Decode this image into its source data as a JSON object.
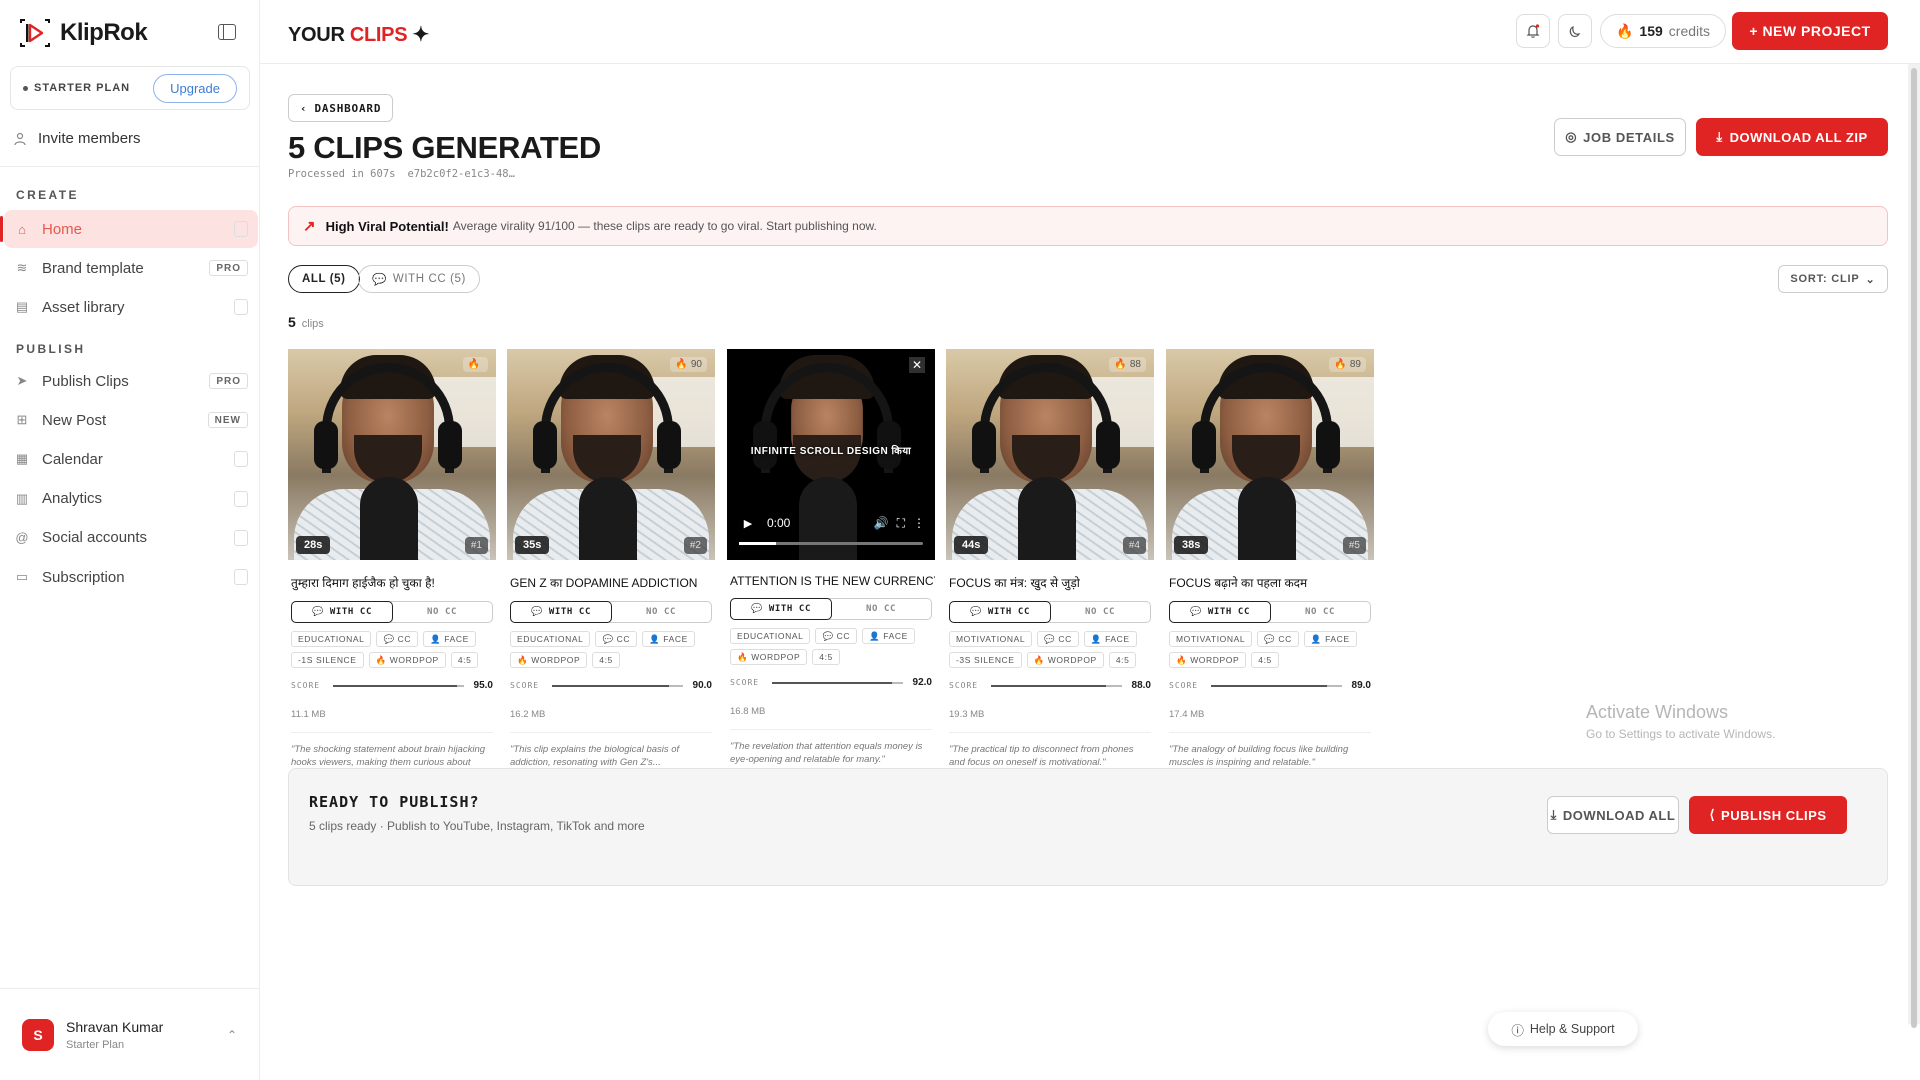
{
  "app": {
    "name": "KlipRok"
  },
  "sidebar": {
    "plan_label": "STARTER PLAN",
    "upgrade_label": "Upgrade",
    "invite_label": "Invite members",
    "create_title": "CREATE",
    "publish_title": "PUBLISH",
    "create_items": [
      {
        "label": "Home",
        "icon": "home-icon",
        "tag": "",
        "active": true
      },
      {
        "label": "Brand template",
        "icon": "layers-icon",
        "tag": "PRO"
      },
      {
        "label": "Asset library",
        "icon": "archive-icon",
        "tag": ""
      }
    ],
    "publish_items": [
      {
        "label": "Publish Clips",
        "icon": "send-icon",
        "tag": "PRO"
      },
      {
        "label": "New Post",
        "icon": "plus-square-icon",
        "tag": "NEW"
      },
      {
        "label": "Calendar",
        "icon": "calendar-icon",
        "tag": ""
      },
      {
        "label": "Analytics",
        "icon": "bar-chart-icon",
        "tag": ""
      },
      {
        "label": "Social accounts",
        "icon": "at-sign-icon",
        "tag": ""
      },
      {
        "label": "Subscription",
        "icon": "credit-card-icon",
        "tag": ""
      }
    ],
    "user": {
      "initial": "S",
      "name": "Shravan Kumar",
      "plan": "Starter Plan"
    }
  },
  "header": {
    "title_prefix": "YOUR ",
    "title_accent": "CLIPS",
    "title_suffix": " ✦",
    "credits_value": "159",
    "credits_label": "credits",
    "new_project_label": "+ NEW PROJECT"
  },
  "main": {
    "back_label": "DASHBOARD",
    "title": "5 CLIPS GENERATED",
    "processed": "Processed in 607s",
    "job_id": "e7b2c0f2-e1c3-48…",
    "job_details_label": "JOB DETAILS",
    "download_zip_label": "DOWNLOAD ALL ZIP",
    "banner_title": "High Viral Potential!",
    "banner_text": "Average virality 91/100 — these clips are ready to go viral. Start publishing now.",
    "filter_all": "ALL (5)",
    "filter_cc": "WITH CC (5)",
    "sort_label": "SORT: CLIP",
    "count_value": "5",
    "count_label": "clips",
    "accent_color": "#e02424"
  },
  "clips": [
    {
      "duration": "28s",
      "rank": "#1",
      "virality": "",
      "title": "तुम्हारा दिमाग हाईजैक हो चुका है!",
      "tags": [
        "EDUCATIONAL",
        "CC",
        "FACE",
        "-1S SILENCE",
        "WORDPOP",
        "4:5"
      ],
      "score": "95.0",
      "score_fraction": 0.95,
      "size": "11.1 MB",
      "reason": "\"The shocking statement about brain hijacking hooks viewers, making them curious about the...",
      "player": false
    },
    {
      "duration": "35s",
      "rank": "#2",
      "virality": "90",
      "title": "GEN Z का DOPAMINE ADDICTION",
      "tags": [
        "EDUCATIONAL",
        "CC",
        "FACE",
        "WORDPOP",
        "4:5"
      ],
      "score": "90.0",
      "score_fraction": 0.9,
      "size": "16.2 MB",
      "reason": "\"This clip explains the biological basis of addiction, resonating with Gen Z's...",
      "player": false
    },
    {
      "duration": "",
      "rank": "",
      "virality": "",
      "title": "ATTENTION IS THE NEW CURRENCY",
      "tags": [
        "EDUCATIONAL",
        "CC",
        "FACE",
        "WORDPOP",
        "4:5"
      ],
      "score": "92.0",
      "score_fraction": 0.92,
      "size": "16.8 MB",
      "reason": "\"The revelation that attention equals money is eye-opening and relatable for many.\"",
      "player": true,
      "caption": "INFINITE SCROLL DESIGN किया",
      "time": "0:00"
    },
    {
      "duration": "44s",
      "rank": "#4",
      "virality": "88",
      "title": "FOCUS का मंत्र: खुद से जुड़ो",
      "tags": [
        "MOTIVATIONAL",
        "CC",
        "FACE",
        "-3S SILENCE",
        "WORDPOP",
        "4:5"
      ],
      "score": "88.0",
      "score_fraction": 0.88,
      "size": "19.3 MB",
      "reason": "\"The practical tip to disconnect from phones and focus on oneself is motivational.\"",
      "player": false
    },
    {
      "duration": "38s",
      "rank": "#5",
      "virality": "89",
      "title": "FOCUS बढ़ाने का पहला कदम",
      "tags": [
        "MOTIVATIONAL",
        "CC",
        "FACE",
        "WORDPOP",
        "4:5"
      ],
      "score": "89.0",
      "score_fraction": 0.89,
      "size": "17.4 MB",
      "reason": "\"The analogy of building focus like building muscles is inspiring and relatable.\"",
      "player": false
    }
  ],
  "clip_labels": {
    "with_cc": "WITH CC",
    "no_cc": "NO CC",
    "score": "SCORE",
    "download": "WITH CC"
  },
  "publish_panel": {
    "title": "READY TO PUBLISH?",
    "subtitle": "5 clips ready · Publish to YouTube, Instagram, TikTok and more",
    "download_all_label": "DOWNLOAD ALL",
    "publish_label": "PUBLISH CLIPS"
  },
  "watermark": {
    "line1": "Activate Windows",
    "line2": "Go to Settings to activate Windows."
  },
  "help_label": "Help & Support"
}
